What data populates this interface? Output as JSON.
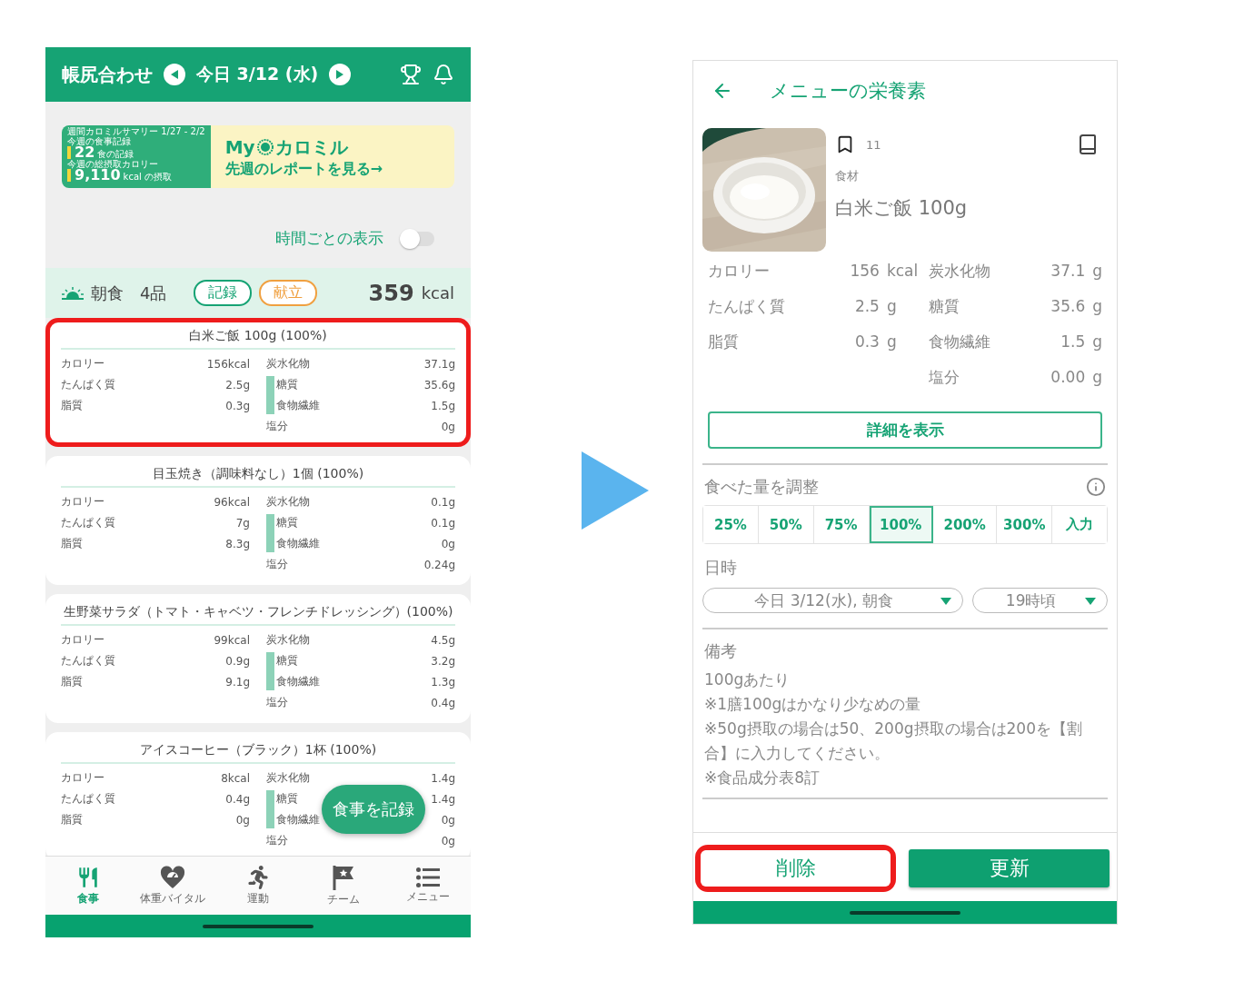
{
  "left_screen": {
    "header": {
      "title": "帳尻合わせ",
      "date": "今日 3/12 (水)"
    },
    "banner": {
      "summary_title": "週間カロミルサマリー 1/27 - 2/2",
      "stats": [
        {
          "label": "今週の食事記録",
          "value": "22",
          "unit": "食の記録"
        },
        {
          "label": "今週の総摂取カロリー",
          "value": "9,110",
          "unit": "kcal の摂取"
        }
      ],
      "brand_prefix": "My",
      "brand_name": "カロミル",
      "cta": "先週のレポートを見る→"
    },
    "hourly_toggle": {
      "label": "時間ごとの表示",
      "on": false
    },
    "meal": {
      "name": "朝食",
      "count": "4品",
      "record_button": "記録",
      "menu_button": "献立",
      "calories": "359",
      "unit": "kcal"
    },
    "foods": [
      {
        "title": "白米ご飯 100g (100%)",
        "highlighted": true,
        "left": [
          {
            "label": "カロリー",
            "value": "156kcal"
          },
          {
            "label": "たんぱく質",
            "value": "2.5g"
          },
          {
            "label": "脂質",
            "value": "0.3g"
          }
        ],
        "right": [
          {
            "kind": "main",
            "label": "炭水化物",
            "value": "37.1g"
          },
          {
            "kind": "sub",
            "label": "糖質",
            "value": "35.6g"
          },
          {
            "kind": "sub",
            "label": "食物繊維",
            "value": "1.5g"
          },
          {
            "kind": "main",
            "label": "塩分",
            "value": "0g"
          }
        ]
      },
      {
        "title": "目玉焼き（調味料なし）1個 (100%)",
        "highlighted": false,
        "left": [
          {
            "label": "カロリー",
            "value": "96kcal"
          },
          {
            "label": "たんぱく質",
            "value": "7g"
          },
          {
            "label": "脂質",
            "value": "8.3g"
          }
        ],
        "right": [
          {
            "kind": "main",
            "label": "炭水化物",
            "value": "0.1g"
          },
          {
            "kind": "sub",
            "label": "糖質",
            "value": "0.1g"
          },
          {
            "kind": "sub",
            "label": "食物繊維",
            "value": "0g"
          },
          {
            "kind": "main",
            "label": "塩分",
            "value": "0.24g"
          }
        ]
      },
      {
        "title": "生野菜サラダ（トマト・キャベツ・フレンチドレッシング）(100%)",
        "highlighted": false,
        "left": [
          {
            "label": "カロリー",
            "value": "99kcal"
          },
          {
            "label": "たんぱく質",
            "value": "0.9g"
          },
          {
            "label": "脂質",
            "value": "9.1g"
          }
        ],
        "right": [
          {
            "kind": "main",
            "label": "炭水化物",
            "value": "4.5g"
          },
          {
            "kind": "sub",
            "label": "糖質",
            "value": "3.2g"
          },
          {
            "kind": "sub",
            "label": "食物繊維",
            "value": "1.3g"
          },
          {
            "kind": "main",
            "label": "塩分",
            "value": "0.4g"
          }
        ]
      },
      {
        "title": "アイスコーヒー（ブラック）1杯 (100%)",
        "highlighted": false,
        "left": [
          {
            "label": "カロリー",
            "value": "8kcal"
          },
          {
            "label": "たんぱく質",
            "value": "0.4g"
          },
          {
            "label": "脂質",
            "value": "0g"
          }
        ],
        "right": [
          {
            "kind": "main",
            "label": "炭水化物",
            "value": "1.4g"
          },
          {
            "kind": "sub",
            "label": "糖質",
            "value": "1.4g"
          },
          {
            "kind": "sub",
            "label": "食物繊維",
            "value": "0g"
          },
          {
            "kind": "main",
            "label": "塩分",
            "value": "0g"
          }
        ]
      }
    ],
    "fab": "食事を記録",
    "nav": [
      {
        "kind": "meal",
        "label": "食事",
        "selected": true
      },
      {
        "kind": "vital",
        "label": "体重バイタル",
        "selected": false
      },
      {
        "kind": "exercise",
        "label": "運動",
        "selected": false
      },
      {
        "kind": "team",
        "label": "チーム",
        "selected": false
      },
      {
        "kind": "menu",
        "label": "メニュー",
        "selected": false
      }
    ]
  },
  "right_screen": {
    "header": {
      "title": "メニューの栄養素"
    },
    "item": {
      "bookmarks": "11",
      "category": "食材",
      "name": "白米ご飯 100g"
    },
    "nutrition": [
      {
        "label": "カロリー",
        "value": "156",
        "unit": "kcal",
        "label_2": "炭水化物",
        "value_2": "37.1",
        "unit_2": "g"
      },
      {
        "label": "たんぱく質",
        "value": "2.5",
        "unit": "g",
        "label_2": "糖質",
        "value_2": "35.6",
        "unit_2": "g"
      },
      {
        "label": "脂質",
        "value": "0.3",
        "unit": "g",
        "label_2": "食物繊維",
        "value_2": "1.5",
        "unit_2": "g"
      },
      {
        "label_2": "塩分",
        "value_2": "0.00",
        "unit_2": "g"
      }
    ],
    "detail_button": "詳細を表示",
    "amount": {
      "title": "食べた量を調整",
      "options": [
        {
          "label": "25%",
          "selected": false
        },
        {
          "label": "50%",
          "selected": false
        },
        {
          "label": "75%",
          "selected": false
        },
        {
          "label": "100%",
          "selected": true
        },
        {
          "label": "200%",
          "selected": false
        },
        {
          "label": "300%",
          "selected": false
        },
        {
          "label": "入力",
          "selected": false
        }
      ]
    },
    "datetime": {
      "title": "日時",
      "date": "今日 3/12(水), 朝食",
      "time": "19時頃"
    },
    "notes": {
      "title": "備考",
      "lines": [
        "100gあたり",
        "※1膳100gはかなり少なめの量",
        "※50g摂取の場合は50、200g摂取の場合は200を【割合】に入力してください。",
        "※食品成分表8訂"
      ]
    },
    "delete_button": {
      "label": "削除",
      "highlighted": true
    },
    "update_button": "更新"
  }
}
